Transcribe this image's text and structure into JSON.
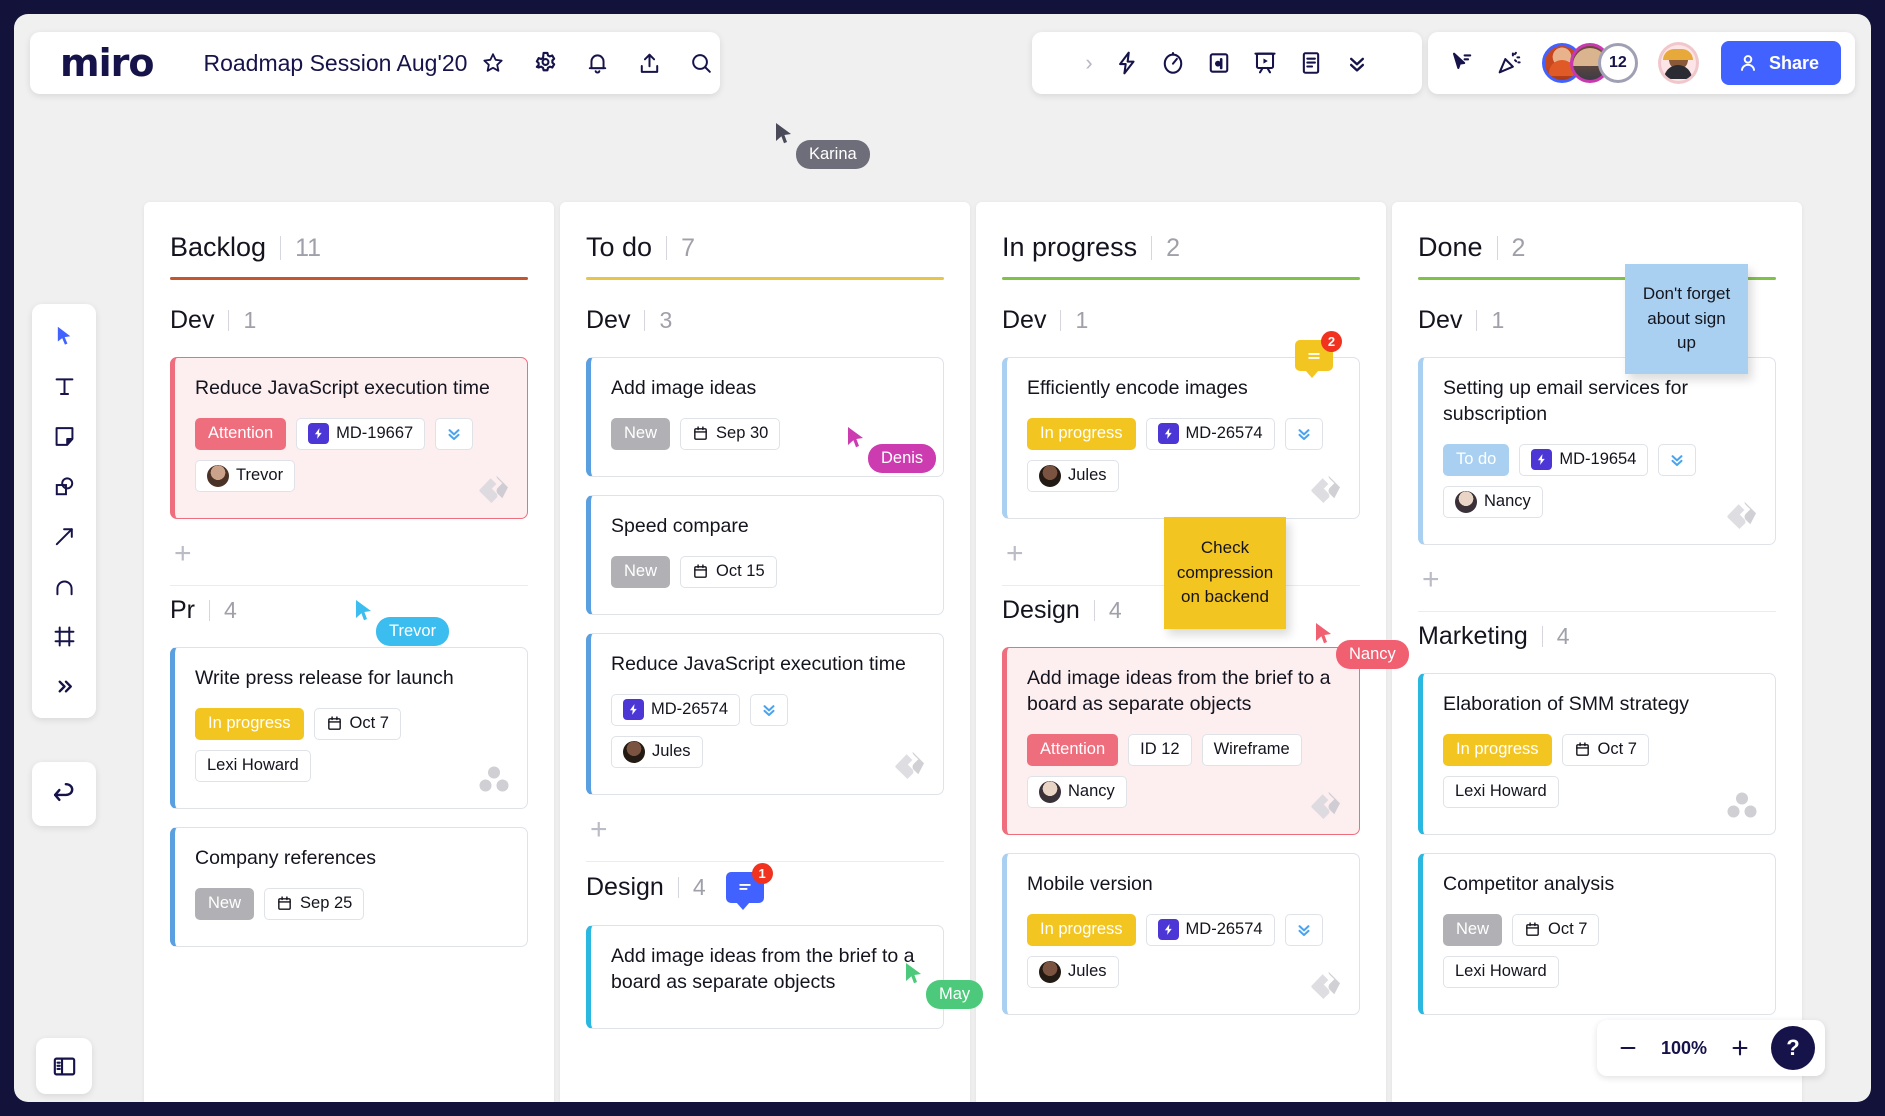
{
  "app": {
    "logo": "miro",
    "board_title": "Roadmap Session Aug'20",
    "zoom_level": "100%",
    "share_label": "Share",
    "collaborator_count": "12"
  },
  "header_icons": [
    {
      "name": "star-icon",
      "glyph": "star"
    },
    {
      "name": "gear-icon",
      "glyph": "gear"
    },
    {
      "name": "bell-icon",
      "glyph": "bell"
    },
    {
      "name": "upload-icon",
      "glyph": "upload"
    },
    {
      "name": "search-icon",
      "glyph": "search"
    }
  ],
  "middle_toolbar_icons": [
    {
      "name": "expand-chevron-icon"
    },
    {
      "name": "lightning-icon"
    },
    {
      "name": "timer-icon"
    },
    {
      "name": "voting-icon"
    },
    {
      "name": "presentation-icon"
    },
    {
      "name": "notes-icon"
    },
    {
      "name": "collapse-chevrons-icon"
    }
  ],
  "right_toolbar_icons": [
    {
      "name": "cursor-chat-icon"
    },
    {
      "name": "celebration-icon"
    }
  ],
  "left_toolbar": [
    {
      "name": "select-tool",
      "active": true
    },
    {
      "name": "text-tool",
      "active": false
    },
    {
      "name": "sticky-note-tool",
      "active": false
    },
    {
      "name": "shapes-tool",
      "active": false
    },
    {
      "name": "arrow-tool",
      "active": false
    },
    {
      "name": "pen-tool",
      "active": false
    },
    {
      "name": "frame-tool",
      "active": false
    },
    {
      "name": "more-tools",
      "active": false
    }
  ],
  "colors": {
    "brand_blue": "#4262ff",
    "backlog_rule": "#c2562f",
    "todo_rule": "#e8c44a",
    "inprogress_rule": "#7ec24a",
    "done_rule": "#7ec24a",
    "attention_badge": "#ef6e7e",
    "inprogress_badge": "#f2c521",
    "new_badge": "#b0b0b5",
    "todo_badge": "#a9d0f0",
    "card_border_blue": "#5a9fe0",
    "card_border_cyan": "#2bb8e0",
    "card_border_red": "#ef6e7e",
    "sticky_yellow": "#f2c521",
    "sticky_blue": "#a9d0f0"
  },
  "columns": [
    {
      "title": "Backlog",
      "count": "11",
      "rule_color": "#c2562f",
      "groups": [
        {
          "name": "Dev",
          "count": "1",
          "cards": [
            {
              "title": "Reduce JavaScript execution time",
              "border": "#ef6e7e",
              "tint": true,
              "status": {
                "label": "Attention",
                "color": "#ef6e7e"
              },
              "ticket": "MD-19667",
              "priority": true,
              "assignee": "Trevor",
              "assignee_avatar": "trevor",
              "integration": "jira"
            }
          ],
          "add_row": true
        },
        {
          "name": "Pr",
          "count": "4",
          "cards": [
            {
              "title": "Write press release for launch",
              "border": "#5a9fe0",
              "tint": false,
              "status": {
                "label": "In progress",
                "color": "#f2c521"
              },
              "date": "Oct 7",
              "assignee": "Lexi Howard",
              "integration": "asana"
            },
            {
              "title": "Company references",
              "border": "#5a9fe0",
              "tint": false,
              "status": {
                "label": "New",
                "color": "#b0b0b5"
              },
              "date": "Sep 25"
            }
          ],
          "add_row": false
        }
      ]
    },
    {
      "title": "To do",
      "count": "7",
      "rule_color": "#e8c44a",
      "groups": [
        {
          "name": "Dev",
          "count": "3",
          "cards": [
            {
              "title": "Add image ideas",
              "border": "#5a9fe0",
              "tint": false,
              "status": {
                "label": "New",
                "color": "#b0b0b5"
              },
              "date": "Sep 30"
            },
            {
              "title": "Speed compare",
              "border": "#5a9fe0",
              "tint": false,
              "status": {
                "label": "New",
                "color": "#b0b0b5"
              },
              "date": "Oct 15"
            },
            {
              "title": "Reduce JavaScript execution time",
              "border": "#5a9fe0",
              "tint": false,
              "ticket": "MD-26574",
              "priority": true,
              "assignee": "Jules",
              "assignee_avatar": "jules",
              "integration": "jira"
            }
          ],
          "add_row": true
        },
        {
          "name": "Design",
          "count": "4",
          "comment_badge": {
            "count": "1",
            "color": "#4262ff"
          },
          "cards": [
            {
              "title": "Add image ideas from the brief to a board as separate objects",
              "border": "#2bb8e0",
              "tint": false
            }
          ],
          "add_row": false
        }
      ]
    },
    {
      "title": "In progress",
      "count": "2",
      "rule_color": "#7ec24a",
      "groups": [
        {
          "name": "Dev",
          "count": "1",
          "cards": [
            {
              "title": "Efficiently encode images",
              "border": "#a9d0f0",
              "tint": false,
              "status": {
                "label": "In progress",
                "color": "#f2c521"
              },
              "ticket": "MD-26574",
              "priority": true,
              "assignee": "Jules",
              "assignee_avatar": "jules",
              "integration": "jira",
              "comment_badge": {
                "count": "2",
                "color": "#f2c521"
              }
            }
          ],
          "add_row": true
        },
        {
          "name": "Design",
          "count": "4",
          "cards": [
            {
              "title": "Add image ideas from the brief to a board as separate objects",
              "border": "#ef6e7e",
              "tint": true,
              "status": {
                "label": "Attention",
                "color": "#ef6e7e"
              },
              "tags": [
                "ID 12",
                "Wireframe"
              ],
              "assignee": "Nancy",
              "assignee_avatar": "nancy",
              "integration": "jira"
            },
            {
              "title": "Mobile version",
              "border": "#a9d0f0",
              "tint": false,
              "status": {
                "label": "In progress",
                "color": "#f2c521"
              },
              "ticket": "MD-26574",
              "priority": true,
              "assignee": "Jules",
              "assignee_avatar": "jules",
              "integration": "jira"
            }
          ],
          "add_row": false
        }
      ]
    },
    {
      "title": "Done",
      "count": "2",
      "rule_color": "#7ec24a",
      "groups": [
        {
          "name": "Dev",
          "count": "1",
          "cards": [
            {
              "title": "Setting up email services for subscription",
              "border": "#a9d0f0",
              "tint": false,
              "status": {
                "label": "To do",
                "color": "#a9d0f0"
              },
              "ticket": "MD-19654",
              "priority": true,
              "assignee": "Nancy",
              "assignee_avatar": "nancy",
              "integration": "jira"
            }
          ],
          "add_row": true
        },
        {
          "name": "Marketing",
          "count": "4",
          "cards": [
            {
              "title": "Elaboration of SMM strategy",
              "border": "#2bb8e0",
              "tint": false,
              "status": {
                "label": "In progress",
                "color": "#f2c521"
              },
              "date": "Oct 7",
              "assignee": "Lexi Howard",
              "integration": "asana"
            },
            {
              "title": "Competitor analysis",
              "border": "#2bb8e0",
              "tint": false,
              "status": {
                "label": "New",
                "color": "#b0b0b5"
              },
              "date": "Oct 7",
              "assignee": "Lexi Howard"
            }
          ],
          "add_row": false
        }
      ]
    }
  ],
  "sticky_notes": [
    {
      "name": "sticky-note-signup",
      "text": "Don't forget about sign up",
      "color": "#a9d0f0"
    },
    {
      "name": "sticky-note-compression",
      "text": "Check compression on backend",
      "color": "#f2c521"
    }
  ],
  "cursors": [
    {
      "name": "Karina",
      "color": "#6e6e7a",
      "arrow": "#4a4a58"
    },
    {
      "name": "Trevor",
      "color": "#3cbdf0",
      "arrow": "#3cbdf0"
    },
    {
      "name": "Denis",
      "color": "#cc3bb0",
      "arrow": "#cc3bb0"
    },
    {
      "name": "Nancy",
      "color": "#f06070",
      "arrow": "#f06070"
    },
    {
      "name": "May",
      "color": "#4cc97a",
      "arrow": "#4cc97a"
    }
  ]
}
